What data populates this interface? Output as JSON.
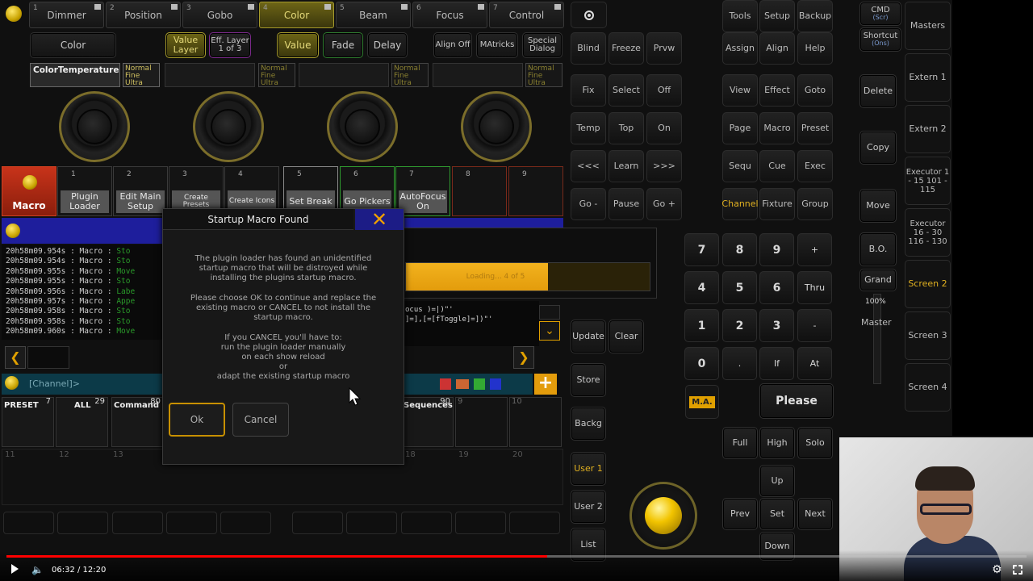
{
  "presetTabs": [
    {
      "n": "1",
      "label": "Dimmer"
    },
    {
      "n": "2",
      "label": "Position"
    },
    {
      "n": "3",
      "label": "Gobo"
    },
    {
      "n": "4",
      "label": "Color"
    },
    {
      "n": "5",
      "label": "Beam"
    },
    {
      "n": "6",
      "label": "Focus"
    },
    {
      "n": "7",
      "label": "Control"
    }
  ],
  "featureButton": "Color",
  "valueLayer": "Value Layer",
  "effLayer": [
    "Eff. Layer",
    "1 of 3"
  ],
  "valueBtn": "Value",
  "fadeBtn": "Fade",
  "delayBtn": "Delay",
  "alignOff": "Align Off",
  "mAtricks": "MAtricks",
  "specialDialog": [
    "Special",
    "Dialog"
  ],
  "encoderAttr": "ColorTemperature",
  "resolution": [
    "Normal",
    "Fine",
    "Ultra"
  ],
  "macroLabel": "Macro",
  "executors": [
    {
      "n": "1",
      "label": "Plugin Loader"
    },
    {
      "n": "2",
      "label": "Edit Main Setup"
    },
    {
      "n": "3",
      "label": "Create Presets"
    },
    {
      "n": "4",
      "label": "Create Icons"
    },
    {
      "n": "5",
      "label": "Set Break"
    },
    {
      "n": "6",
      "label": "Go Pickers"
    },
    {
      "n": "7",
      "label": "AutoFocus On"
    },
    {
      "n": "8",
      "label": ""
    },
    {
      "n": "9",
      "label": ""
    }
  ],
  "log": [
    {
      "t": "20h58m09.954s",
      "s": "Macro",
      "st": "Sto"
    },
    {
      "t": "20h58m09.954s",
      "s": "Macro",
      "st": "Sto"
    },
    {
      "t": "20h58m09.955s",
      "s": "Macro",
      "st": "Move"
    },
    {
      "t": "20h58m09.955s",
      "s": "Macro",
      "st": "Sto"
    },
    {
      "t": "20h58m09.956s",
      "s": "Macro",
      "st": "Labe"
    },
    {
      "t": "20h58m09.957s",
      "s": "Macro",
      "st": "Appe"
    },
    {
      "t": "20h58m09.958s",
      "s": "Macro",
      "st": "Sto"
    },
    {
      "t": "20h58m09.958s",
      "s": "Macro",
      "st": "Sto"
    },
    {
      "t": "20h58m09.960s",
      "s": "Macro",
      "st": "Move"
    }
  ],
  "cmdSnippet1": "ocus )=|)\"'",
  "cmdSnippet2": "]=],[=[fToggle]=])\"'",
  "channelLabel": "[Channel]>",
  "progress": {
    "text": "Loading... 4 of 5",
    "fraction": 0.8
  },
  "pools": [
    {
      "label": "PRESET",
      "n": "7"
    },
    {
      "label": "ALL",
      "n": "29"
    },
    {
      "label": "Command",
      "n": "80"
    }
  ],
  "poolSequences": {
    "label": "Sequences",
    "n": "90"
  },
  "poolNums": [
    "9",
    "10",
    "11",
    "12",
    "13",
    "18",
    "19",
    "20"
  ],
  "dialog": {
    "title": "Startup Macro Found",
    "p1": [
      "The plugin loader has found an unidentified",
      "startup macro that will be distroyed while",
      "installing the plugins startup macro."
    ],
    "p2": [
      "Please choose OK to continue and replace the",
      "existing macro or CANCEL to not install the",
      "startup macro."
    ],
    "p3": [
      "If you CANCEL you'll have to:",
      "run the plugin loader manually",
      "on each show reload",
      "or",
      "adapt the existing startup macro"
    ],
    "ok": "Ok",
    "cancel": "Cancel"
  },
  "leftCol": [
    "Blind",
    "Freeze",
    "Prvw",
    "Fix",
    "Select",
    "Off",
    "Temp",
    "Top",
    "On",
    "<<<",
    "Learn",
    ">>>",
    "Go -",
    "Pause",
    "Go +"
  ],
  "midCol": [
    "Update",
    "Clear",
    "Store",
    "Backg",
    "User 1",
    "User 2",
    "List"
  ],
  "tools": [
    "Tools",
    "Setup",
    "Backup",
    "Assign",
    "Align",
    "Help",
    "View",
    "Effect",
    "Goto",
    "Page",
    "Macro",
    "Preset",
    "Sequ",
    "Cue",
    "Exec",
    "Channel",
    "Fixture",
    "Group"
  ],
  "numpad": [
    "7",
    "8",
    "9",
    "+",
    "4",
    "5",
    "6",
    "Thru",
    "1",
    "2",
    "3",
    "-",
    "0",
    ".",
    "If",
    "At"
  ],
  "ma": "M.A.",
  "please": "Please",
  "fhs": [
    "Full",
    "High",
    "Solo"
  ],
  "nav": {
    "up": "Up",
    "prev": "Prev",
    "set": "Set",
    "next": "Next",
    "down": "Down"
  },
  "cmdBtn": [
    "CMD",
    "(Scr)"
  ],
  "shortcutBtn": [
    "Shortcut",
    "(Ons)"
  ],
  "deleteBtn": "Delete",
  "copyBtn": "Copy",
  "moveBtn": "Move",
  "boBtn": "B.O.",
  "grandBtn": "Grand",
  "grandPct": "100%",
  "masterBtn": "Master",
  "sideMasters": [
    "Masters",
    "Extern 1",
    "Extern 2",
    "Executor 1 - 15 101 - 115",
    "Executor 16 - 30 116 - 130",
    "Screen 2",
    "Screen 3",
    "Screen 4"
  ],
  "player": {
    "time": "06:32 / 12:20",
    "played": 0.53
  }
}
